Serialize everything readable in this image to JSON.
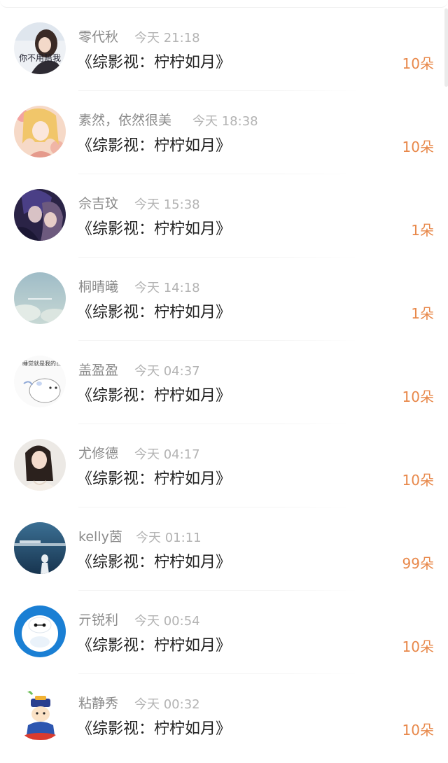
{
  "gift_list": [
    {
      "user": "零代秋",
      "time": "今天 21:18",
      "book": "《综影视：柠柠如月》",
      "flowers": "10朵",
      "avatar_text": "你不用陪我",
      "avatar": "girl-photo-avatar"
    },
    {
      "user": "素然，依然很美",
      "time": "今天 18:38",
      "book": "《综影视：柠柠如月》",
      "flowers": "10朵",
      "avatar": "anime-girl-avatar"
    },
    {
      "user": "佘吉玟",
      "time": "今天 15:38",
      "book": "《综影视：柠柠如月》",
      "flowers": "1朵",
      "avatar": "anime-couple-avatar"
    },
    {
      "user": "桐晴曦",
      "time": "今天 14:18",
      "book": "《综影视：柠柠如月》",
      "flowers": "1朵",
      "avatar": "sky-avatar"
    },
    {
      "user": "盖盈盈",
      "time": "今天 04:37",
      "book": "《综影视：柠柠如月》",
      "flowers": "10朵",
      "avatar_text": "睡觉就是我的日",
      "avatar": "hamster-cartoon-avatar"
    },
    {
      "user": "尤修德",
      "time": "今天 04:17",
      "book": "《综影视：柠柠如月》",
      "flowers": "10朵",
      "avatar": "woman-photo-avatar"
    },
    {
      "user": "kelly茵",
      "time": "今天 01:11",
      "book": "《综影视：柠柠如月》",
      "flowers": "99朵",
      "avatar": "seaside-avatar"
    },
    {
      "user": "亓锐利",
      "time": "今天 00:54",
      "book": "《综影视：柠柠如月》",
      "flowers": "10朵",
      "avatar": "baymax-avatar"
    },
    {
      "user": "粘静秀",
      "time": "今天 00:32",
      "book": "《综影视：柠柠如月》",
      "flowers": "10朵",
      "avatar": "cartoon-kid-avatar"
    }
  ],
  "colors": {
    "username": "#8a8a8a",
    "timestamp": "#b3b3b3",
    "book_title": "#222222",
    "flower_count": "#e8884a"
  }
}
